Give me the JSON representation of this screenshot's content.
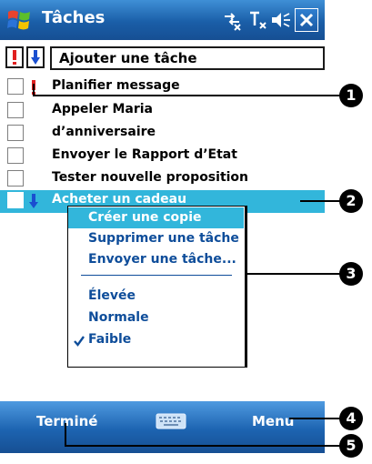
{
  "title_bar": {
    "app_title": "Tâches"
  },
  "command_row": {
    "new_task_placeholder": "Ajouter une tâche"
  },
  "tasks": [
    {
      "label": "Planifier message",
      "priority": "high"
    },
    {
      "label": "Appeler Maria",
      "priority": "normal"
    },
    {
      "label": "d’anniversaire",
      "priority": "normal"
    },
    {
      "label": "Envoyer le Rapport d’Etat",
      "priority": "normal"
    },
    {
      "label": "Tester nouvelle proposition",
      "priority": "normal"
    },
    {
      "label": "Acheter un cadeau",
      "priority": "low",
      "selected": true
    }
  ],
  "context_menu": {
    "items": [
      {
        "label": "Créer une copie",
        "highlighted": true
      },
      {
        "label": "Supprimer une tâche"
      },
      {
        "label": "Envoyer une tâche..."
      },
      {
        "label": "Élevée"
      },
      {
        "label": "Normale"
      },
      {
        "label": "Faible",
        "checked": true
      }
    ]
  },
  "softkeys": {
    "left": "Terminé",
    "right": "Menu"
  },
  "callouts": [
    "1",
    "2",
    "3",
    "4",
    "5"
  ],
  "colors": {
    "title_bar": "#1a5ea8",
    "selection": "#32b6db",
    "menu_text": "#0e4d9a",
    "priority_high": "#e02020",
    "priority_low": "#1a4fd0"
  }
}
